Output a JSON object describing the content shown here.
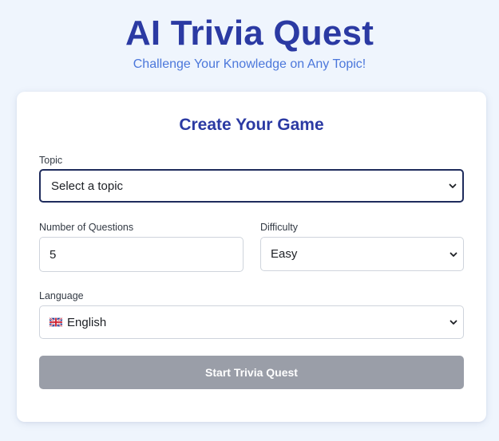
{
  "header": {
    "title": "AI Trivia Quest",
    "subtitle": "Challenge Your Knowledge on Any Topic!"
  },
  "form": {
    "title": "Create Your Game",
    "topic": {
      "label": "Topic",
      "selected": "Select a topic"
    },
    "num_questions": {
      "label": "Number of Questions",
      "value": "5"
    },
    "difficulty": {
      "label": "Difficulty",
      "selected": "Easy"
    },
    "language": {
      "label": "Language",
      "selected": "English",
      "flag_icon": "uk-flag-icon"
    },
    "start_label": "Start Trivia Quest"
  },
  "colors": {
    "background": "#eff5fd",
    "title": "#2b3aa3",
    "subtitle": "#4b77db",
    "button_disabled": "#9a9ea8",
    "focus_border": "#1e2b5c"
  }
}
